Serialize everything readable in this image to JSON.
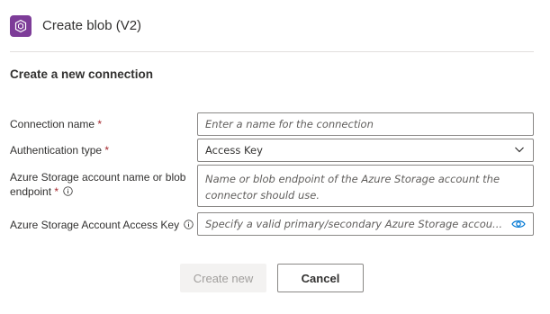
{
  "header": {
    "title": "Create blob (V2)",
    "icon": "blob-storage-icon",
    "icon_color": "#7d3c98"
  },
  "form": {
    "section_title": "Create a new connection",
    "connection_name": {
      "label": "Connection name",
      "required_mark": "*",
      "placeholder": "Enter a name for the connection",
      "value": ""
    },
    "auth_type": {
      "label": "Authentication type",
      "required_mark": "*",
      "value": "Access Key"
    },
    "account_name": {
      "label": "Azure Storage account name or blob endpoint",
      "required_mark": "*",
      "placeholder": "Name or blob endpoint of the Azure Storage account the connector should use.",
      "value": ""
    },
    "access_key": {
      "label": "Azure Storage Account Access Key",
      "placeholder": "Specify a valid primary/secondary Azure Storage accou...",
      "value": ""
    }
  },
  "actions": {
    "create_label": "Create new",
    "cancel_label": "Cancel"
  },
  "colors": {
    "accent": "#0078d4",
    "required": "#a4262c",
    "disabled_bg": "#f3f2f1"
  }
}
